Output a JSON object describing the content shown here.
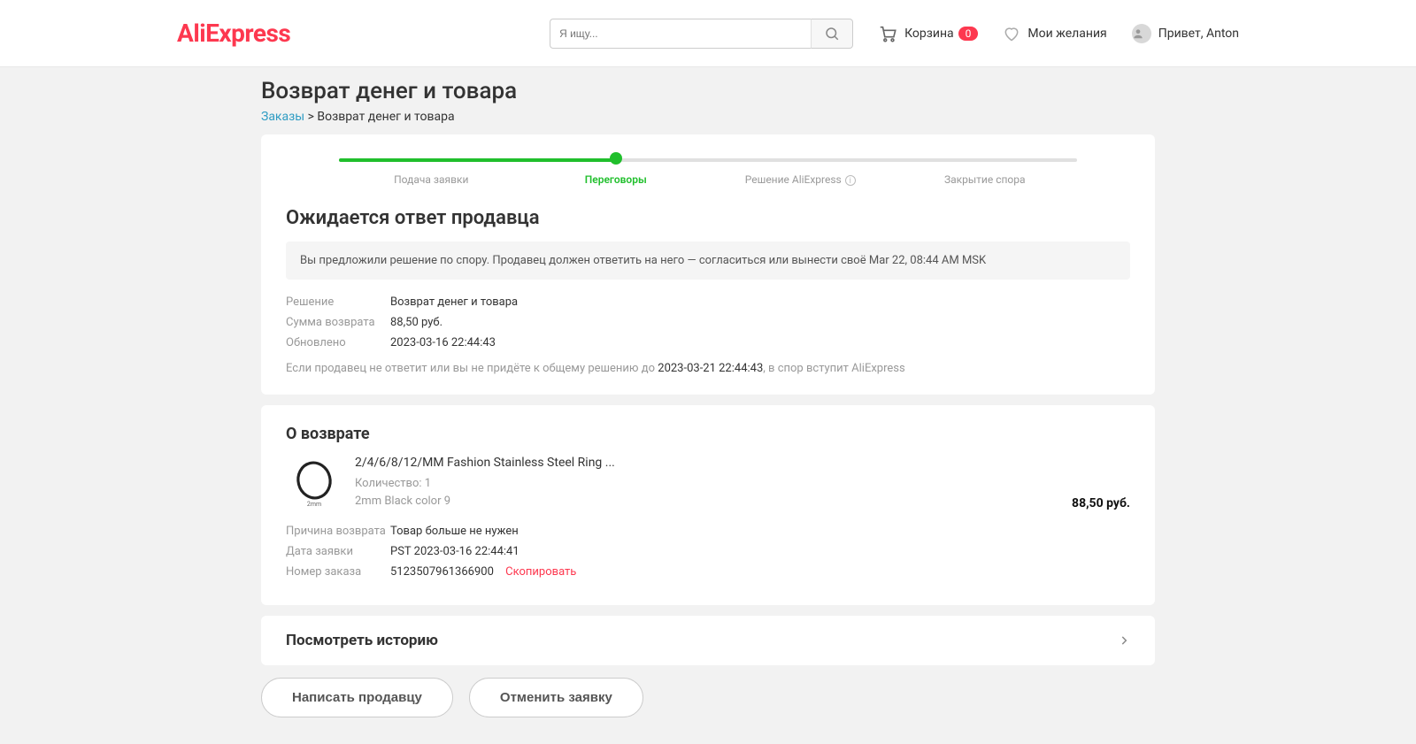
{
  "header": {
    "logo": "AliExpress",
    "search_placeholder": "Я ищу...",
    "cart_label": "Корзина",
    "cart_count": "0",
    "wishlist_label": "Мои желания",
    "greeting": "Привет, Anton"
  },
  "page": {
    "title": "Возврат денег и товара",
    "breadcrumb_link": "Заказы",
    "breadcrumb_sep": " > ",
    "breadcrumb_current": "Возврат денег и товара"
  },
  "progress": {
    "steps": [
      {
        "label": "Подача заявки"
      },
      {
        "label": "Переговоры"
      },
      {
        "label": "Решение AliExpress"
      },
      {
        "label": "Закрытие спора"
      }
    ],
    "fill_percent": 37
  },
  "status": {
    "title": "Ожидается ответ продавца",
    "banner": "Вы предложили решение по спору. Продавец должен ответить на него — согласиться или вынести своё Mar 22, 08:44 AM MSK",
    "rows": [
      {
        "label": "Решение",
        "value": "Возврат денег и товара"
      },
      {
        "label": "Сумма возврата",
        "value": "88,50 руб."
      },
      {
        "label": "Обновлено",
        "value": "2023-03-16 22:44:43"
      }
    ],
    "deadline_prefix": "Если продавец не ответит или вы не придёте к общему решению до ",
    "deadline_bold": "2023-03-21 22:44:43",
    "deadline_suffix": ", в спор вступит AliExpress"
  },
  "return": {
    "title": "О возврате",
    "product_title": "2/4/6/8/12/MM Fashion Stainless Steel Ring ...",
    "product_qty": "Количество: 1",
    "product_variant": "2mm Black color 9",
    "product_price": "88,50 руб.",
    "rows": [
      {
        "label": "Причина возврата",
        "value": "Товар больше не нужен"
      },
      {
        "label": "Дата заявки",
        "value": "PST 2023-03-16 22:44:41"
      },
      {
        "label": "Номер заказа",
        "value": "5123507961366900"
      }
    ],
    "copy_label": "Скопировать"
  },
  "history": {
    "title": "Посмотреть историю"
  },
  "actions": {
    "contact_seller": "Написать продавцу",
    "cancel_request": "Отменить заявку"
  }
}
